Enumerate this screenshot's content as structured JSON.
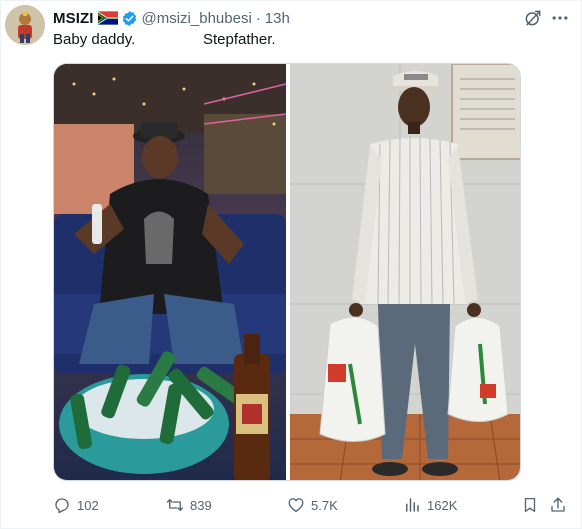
{
  "tweet": {
    "display_name": "MSIZI",
    "handle": "@msizi_bhubesi",
    "separator": "·",
    "time": "13h",
    "text_left": "Baby daddy.",
    "text_right": "Stepfather."
  },
  "icons": {
    "flag": "south-africa-flag-icon",
    "verified": "verified-badge-icon",
    "grok": "grok-icon",
    "more": "more-icon",
    "reply": "reply-icon",
    "retweet": "retweet-icon",
    "like": "heart-icon",
    "views": "views-chart-icon",
    "bookmark": "bookmark-icon",
    "share": "share-icon"
  },
  "actions": {
    "replies": "102",
    "retweets": "839",
    "likes": "5.7K",
    "views": "162K"
  },
  "colors": {
    "text": "#0f1419",
    "secondary": "#536471",
    "verified": "#1d9bf0",
    "border": "#cfd9de"
  }
}
